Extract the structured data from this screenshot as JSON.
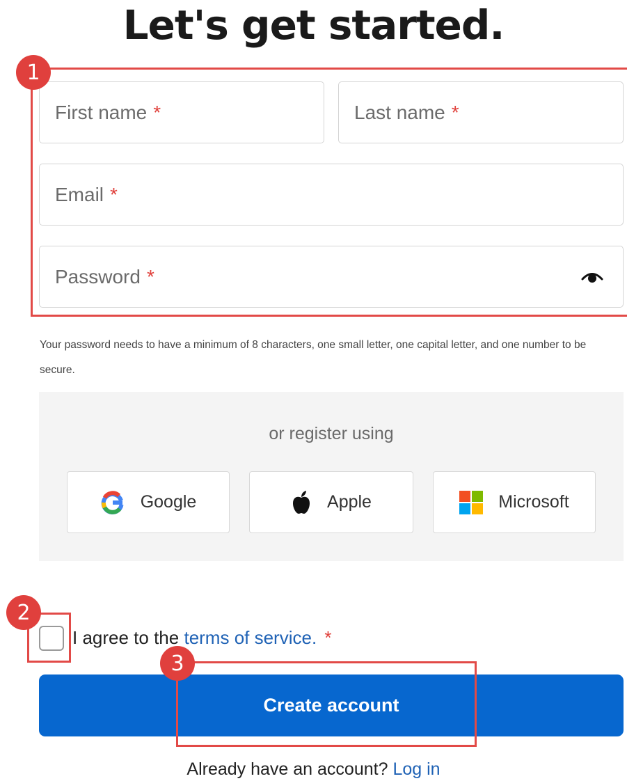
{
  "heading": "Let's get started.",
  "form": {
    "first_name_placeholder": "First name",
    "last_name_placeholder": "Last name",
    "email_placeholder": "Email",
    "password_placeholder": "Password",
    "required_marker": "*",
    "password_hint": "Your password needs to have a minimum of 8 characters, one small letter, one capital letter, and one number to be secure."
  },
  "social": {
    "or_text": "or register using",
    "buttons": [
      {
        "label": "Google",
        "icon": "google-icon"
      },
      {
        "label": "Apple",
        "icon": "apple-icon"
      },
      {
        "label": "Microsoft",
        "icon": "microsoft-icon"
      }
    ]
  },
  "terms": {
    "prefix": "I agree to the",
    "link_text": "terms of service.",
    "required_marker": "*",
    "checked": false
  },
  "create_account_label": "Create account",
  "login": {
    "prompt": "Already have an account?",
    "link_text": "Log in"
  },
  "annotations": [
    "1",
    "2",
    "3"
  ],
  "colors": {
    "primary_button": "#0767cf",
    "link": "#1f62b5",
    "required": "#e0413c",
    "annotation": "#e0403d"
  }
}
